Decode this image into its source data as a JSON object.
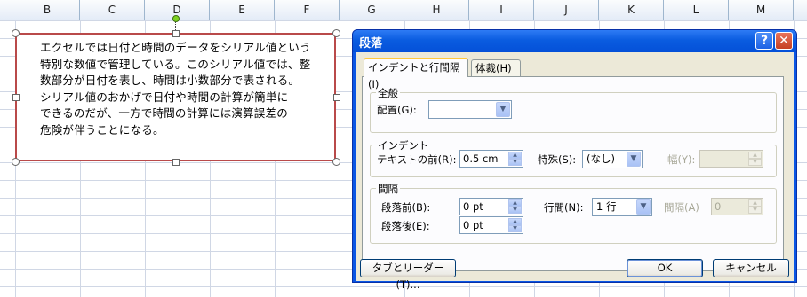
{
  "sheet": {
    "columns": [
      "B",
      "C",
      "D",
      "E",
      "F",
      "G",
      "H",
      "I",
      "J",
      "K",
      "L",
      "M"
    ],
    "textbox_lines": [
      "エクセルでは日付と時間のデータをシリアル値という",
      "特別な数値で管理している。このシリアル値では、整",
      "数部分が日付を表し、時間は小数部分で表される。",
      "シリアル値のおかげで日付や時間の計算が簡単に",
      "できるのだが、一方で時間の計算には演算誤差の",
      "危険が伴うことになる。"
    ]
  },
  "dialog": {
    "title": "段落",
    "help_glyph": "?",
    "close_glyph": "✕",
    "tabs": [
      "インデントと行間隔(I)",
      "体裁(H)"
    ],
    "general": {
      "group_label": "全般",
      "alignment_label": "配置(G):",
      "alignment_value": ""
    },
    "indent": {
      "group_label": "インデント",
      "before_text_label": "テキストの前(R):",
      "before_text_value": "0.5 cm",
      "special_label": "特殊(S):",
      "special_value": "(なし)",
      "by_label": "幅(Y):",
      "by_value": ""
    },
    "spacing": {
      "group_label": "間隔",
      "before_label": "段落前(B):",
      "before_value": "0 pt",
      "after_label": "段落後(E):",
      "after_value": "0 pt",
      "line_spacing_label": "行間(N):",
      "line_spacing_value": "1 行",
      "at_label": "間隔(A)",
      "at_value": "0"
    },
    "buttons": {
      "tabs_leaders": "タブとリーダー(T)...",
      "ok": "OK",
      "cancel": "キャンセル"
    }
  }
}
